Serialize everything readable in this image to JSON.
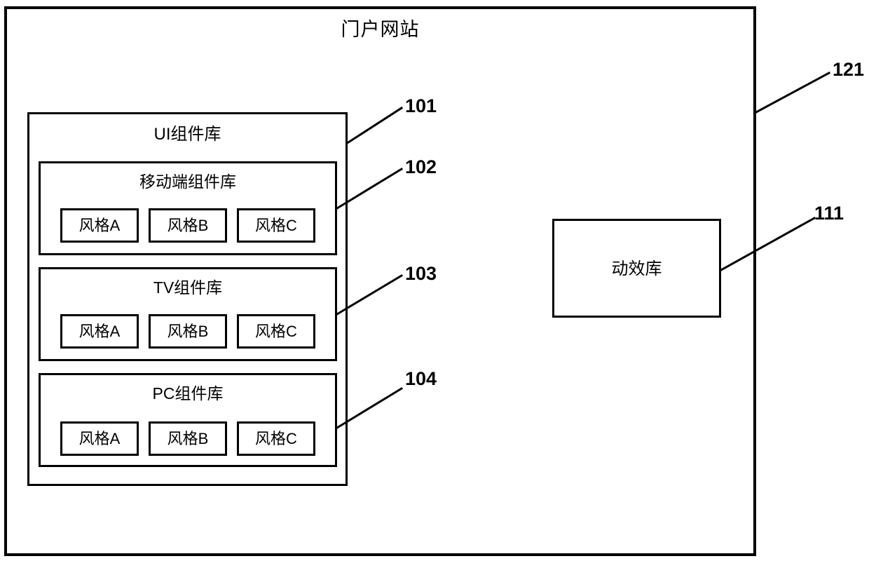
{
  "diagram": {
    "title": "门户网站",
    "outer_ref": "121",
    "ui_library": {
      "title": "UI组件库",
      "ref": "101",
      "groups": [
        {
          "title": "移动端组件库",
          "ref": "102",
          "styles": [
            "风格A",
            "风格B",
            "风格C"
          ]
        },
        {
          "title": "TV组件库",
          "ref": "103",
          "styles": [
            "风格A",
            "风格B",
            "风格C"
          ]
        },
        {
          "title": "PC组件库",
          "ref": "104",
          "styles": [
            "风格A",
            "风格B",
            "风格C"
          ]
        }
      ]
    },
    "motion_library": {
      "title": "动效库",
      "ref": "111"
    },
    "colors": {
      "stroke": "#000000",
      "background": "#ffffff"
    }
  }
}
